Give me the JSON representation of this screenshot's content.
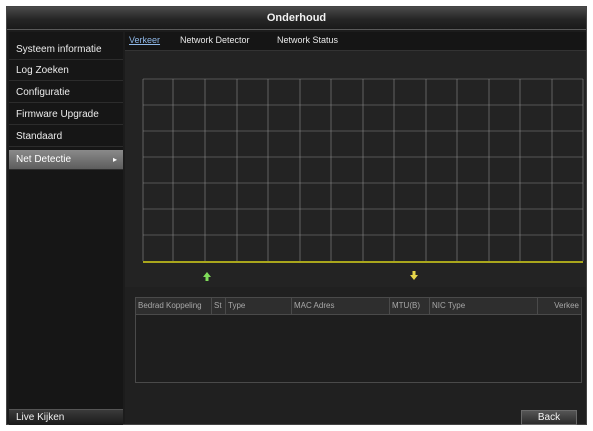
{
  "window": {
    "title": "Onderhoud"
  },
  "sidebar": {
    "items": [
      {
        "label": "Systeem informatie"
      },
      {
        "label": "Log Zoeken"
      },
      {
        "label": "Configuratie"
      },
      {
        "label": "Firmware Upgrade"
      },
      {
        "label": "Standaard"
      },
      {
        "label": "Net Detectie",
        "active": true,
        "chevron": "▸"
      }
    ],
    "live_label": "Live Kijken"
  },
  "tabs": [
    {
      "label": "Verkeer",
      "active": true
    },
    {
      "label": "Network Detector"
    },
    {
      "label": "Network Status"
    }
  ],
  "traffic": {
    "upload_icon": "arrow-up-icon",
    "download_icon": "arrow-down-icon",
    "line_color": "#d6d11a",
    "up_color": "#7fdc5a",
    "down_color": "#e6d64a"
  },
  "table": {
    "columns": [
      "Bedrad Koppeling",
      "St",
      "Type",
      "MAC Adres",
      "MTU(B)",
      "NIC Type",
      "Verkee"
    ]
  },
  "footer": {
    "back_label": "Back"
  }
}
